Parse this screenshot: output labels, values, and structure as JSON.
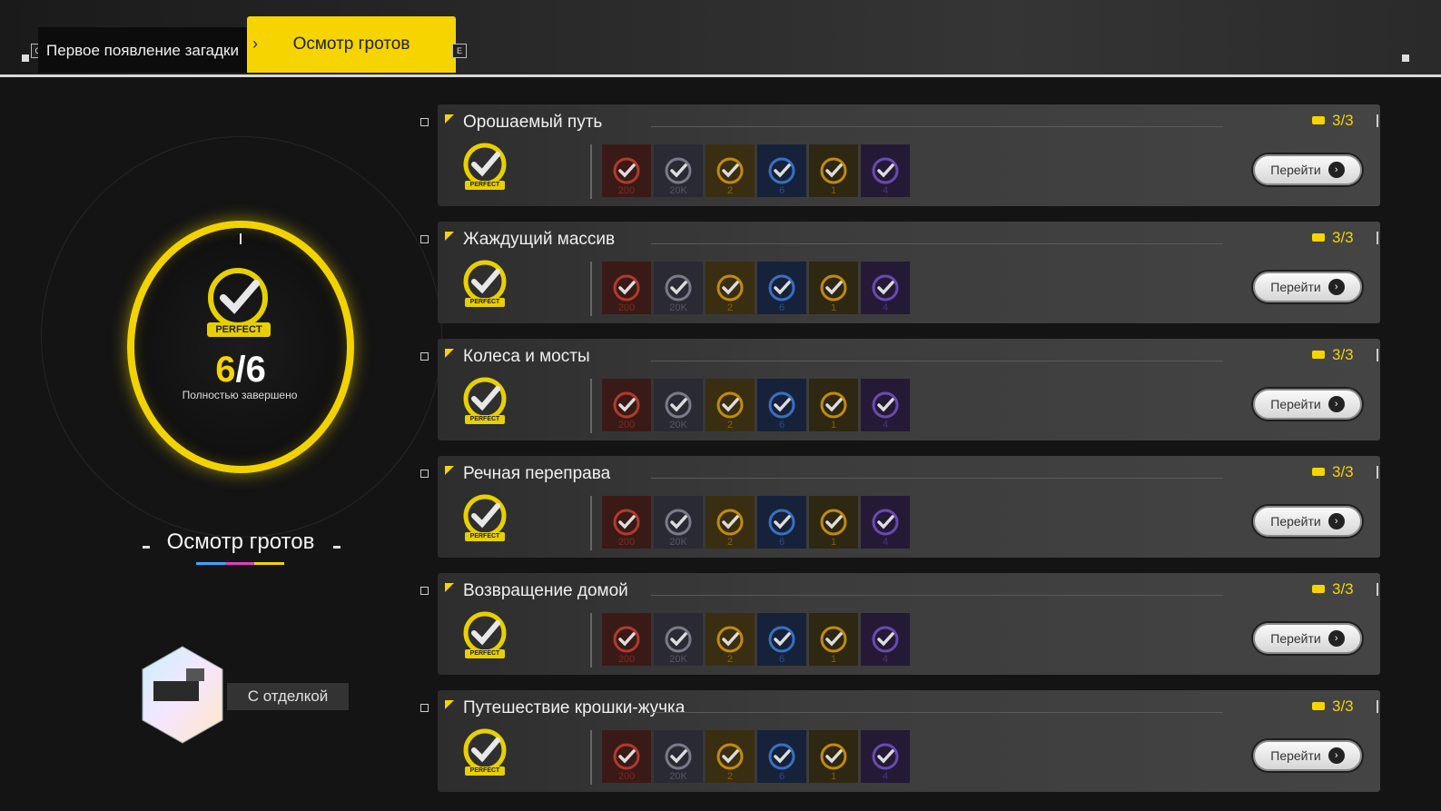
{
  "tabs": [
    {
      "label": "Первое появление загадки",
      "key": "Q"
    },
    {
      "label": "Осмотр гротов",
      "key": "E",
      "active": true
    }
  ],
  "summary": {
    "completed": "6",
    "total": "6",
    "badge": "PERFECT",
    "status": "Полностью завершено",
    "title": "Осмотр гротов",
    "reward_label": "С отделкой"
  },
  "colors": {
    "accent": "#f5d400",
    "background": "#141414"
  },
  "rows": [
    {
      "title": "Орошаемый путь",
      "score": "3/3",
      "button": "Перейти"
    },
    {
      "title": "Жаждущий массив",
      "score": "3/3",
      "button": "Перейти"
    },
    {
      "title": "Колеса и мосты",
      "score": "3/3",
      "button": "Перейти"
    },
    {
      "title": "Речная переправа",
      "score": "3/3",
      "button": "Перейти"
    },
    {
      "title": "Возвращение домой",
      "score": "3/3",
      "button": "Перейти"
    },
    {
      "title": "Путешествие крошки-жучка",
      "score": "3/3",
      "button": "Перейти"
    }
  ],
  "row_badge_pill": "PERFECT",
  "mission_badges": [
    {
      "num": "200",
      "color": "#b03a2e",
      "bg": "#3a1a16"
    },
    {
      "num": "20K",
      "color": "#7a7a8a",
      "bg": "#2a2a34"
    },
    {
      "num": "2",
      "color": "#c08a10",
      "bg": "#3a2e12"
    },
    {
      "num": "6",
      "color": "#3a6fc0",
      "bg": "#16223a"
    },
    {
      "num": "1",
      "color": "#c08a10",
      "bg": "#2e2712"
    },
    {
      "num": "4",
      "color": "#6a4ab0",
      "bg": "#241a36"
    }
  ]
}
